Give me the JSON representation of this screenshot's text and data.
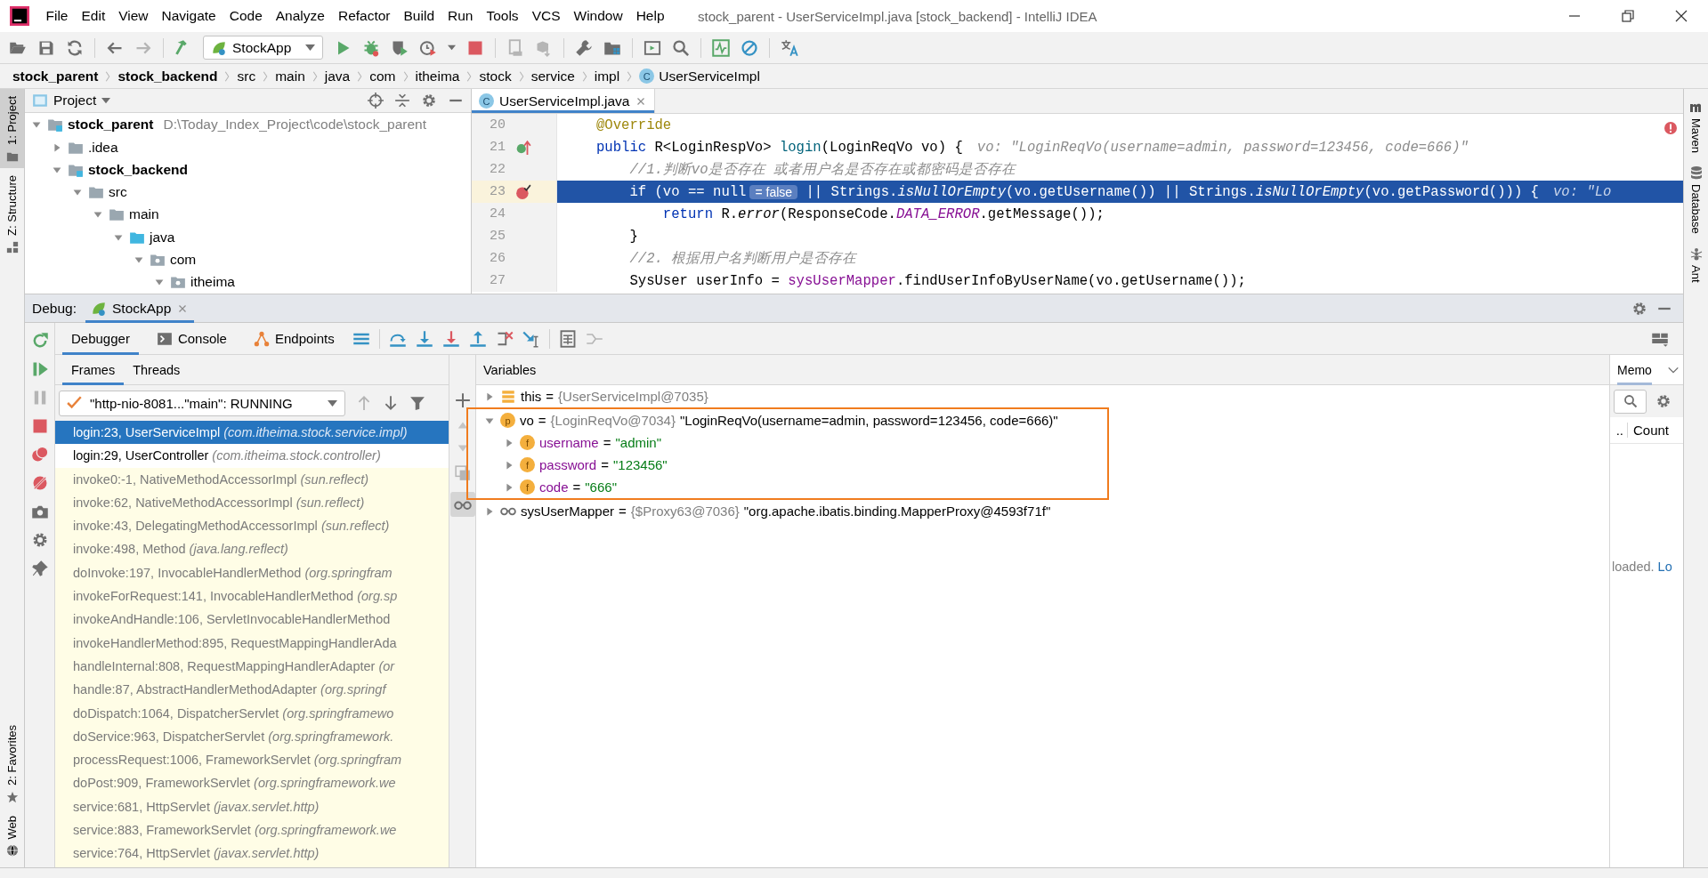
{
  "window": {
    "title": "stock_parent - UserServiceImpl.java [stock_backend] - IntelliJ IDEA"
  },
  "menu": [
    "File",
    "Edit",
    "View",
    "Navigate",
    "Code",
    "Analyze",
    "Refactor",
    "Build",
    "Run",
    "Tools",
    "VCS",
    "Window",
    "Help"
  ],
  "toolbar": {
    "run_configuration": "StockApp"
  },
  "breadcrumb": [
    {
      "label": "stock_parent",
      "kind": "module"
    },
    {
      "label": "stock_backend",
      "kind": "module"
    },
    {
      "label": "src",
      "kind": "folder"
    },
    {
      "label": "main",
      "kind": "folder"
    },
    {
      "label": "java",
      "kind": "folder"
    },
    {
      "label": "com",
      "kind": "folder"
    },
    {
      "label": "itheima",
      "kind": "folder"
    },
    {
      "label": "stock",
      "kind": "folder"
    },
    {
      "label": "service",
      "kind": "folder"
    },
    {
      "label": "impl",
      "kind": "folder"
    },
    {
      "label": "UserServiceImpl",
      "kind": "class",
      "badge": "C"
    }
  ],
  "left_stripe": {
    "top": [
      {
        "label": "1: Project",
        "selected": true
      },
      {
        "label": "Z: Structure",
        "selected": false
      }
    ],
    "bottom": [
      {
        "label": "2: Favorites"
      },
      {
        "label": "Web"
      }
    ]
  },
  "right_stripe": [
    {
      "label": "Maven"
    },
    {
      "label": "Database"
    },
    {
      "label": "Ant"
    }
  ],
  "project": {
    "title": "Project",
    "tree": [
      {
        "label": "stock_parent",
        "detail": "D:\\Today_Index_Project\\code\\stock_parent",
        "kind": "module",
        "expanded": true,
        "children": [
          {
            "label": ".idea",
            "kind": "folder",
            "expanded": false
          },
          {
            "label": "stock_backend",
            "kind": "module",
            "expanded": true,
            "children": [
              {
                "label": "src",
                "kind": "folder",
                "expanded": true,
                "children": [
                  {
                    "label": "main",
                    "kind": "folder",
                    "expanded": true,
                    "children": [
                      {
                        "label": "java",
                        "kind": "source",
                        "expanded": true,
                        "children": [
                          {
                            "label": "com",
                            "kind": "package",
                            "expanded": true,
                            "children": [
                              {
                                "label": "itheima",
                                "kind": "package",
                                "expanded": true
                              }
                            ]
                          }
                        ]
                      }
                    ]
                  }
                ]
              }
            ]
          }
        ]
      }
    ]
  },
  "editor": {
    "tab": {
      "label": "UserServiceImpl.java",
      "badge": "C",
      "selected": true
    },
    "lines": [
      {
        "number": "20",
        "segments": [
          {
            "kind": "code",
            "tokens": [
              {
                "text": "@Override",
                "kind": "annotation"
              }
            ]
          }
        ]
      },
      {
        "number": "21",
        "marker": {
          "kind": "implements"
        },
        "segments": [
          {
            "kind": "code",
            "tokens": [
              {
                "text": "public ",
                "kind": "keyword"
              },
              {
                "text": "R<LoginRespVo> ",
                "kind": "plain"
              },
              {
                "text": "login",
                "kind": "method"
              },
              {
                "text": "(LoginReqVo vo) {",
                "kind": "plain"
              }
            ]
          },
          {
            "kind": "hint",
            "text": "vo: \"LoginReqVo(username=admin, password=123456, code=666)\""
          }
        ]
      },
      {
        "number": "22",
        "segments": [
          {
            "kind": "code",
            "tokens": [
              {
                "text": "    //1.判断vo是否存在 或者用户名是否存在或都密码是否存在",
                "kind": "comment"
              }
            ]
          }
        ]
      },
      {
        "number": "23",
        "marker": {
          "kind": "breakpoint"
        },
        "current": true,
        "segments": [
          {
            "kind": "code",
            "tokens": [
              {
                "text": "    if ",
                "kind": "keyword"
              },
              {
                "text": "(vo == ",
                "kind": "plain"
              },
              {
                "text": "null",
                "kind": "keyword"
              }
            ]
          },
          {
            "kind": "value",
            "text": "= false"
          },
          {
            "kind": "code",
            "tokens": [
              {
                "text": " || Strings.",
                "kind": "plain"
              },
              {
                "text": "isNullOrEmpty",
                "kind": "static"
              },
              {
                "text": "(vo.getUsername()) || Strings.",
                "kind": "plain"
              },
              {
                "text": "isNullOrEmpty",
                "kind": "static"
              },
              {
                "text": "(vo.getPassword())) {",
                "kind": "plain"
              }
            ]
          },
          {
            "kind": "hint",
            "text": "vo: \"Lo"
          }
        ]
      },
      {
        "number": "24",
        "segments": [
          {
            "kind": "code",
            "tokens": [
              {
                "text": "        return ",
                "kind": "keyword"
              },
              {
                "text": "R.",
                "kind": "plain"
              },
              {
                "text": "error",
                "kind": "static"
              },
              {
                "text": "(ResponseCode.",
                "kind": "plain"
              },
              {
                "text": "DATA_ERROR",
                "kind": "constant"
              },
              {
                "text": ".getMessage());",
                "kind": "plain"
              }
            ]
          }
        ]
      },
      {
        "number": "25",
        "segments": [
          {
            "kind": "code",
            "tokens": [
              {
                "text": "    }",
                "kind": "plain"
              }
            ]
          }
        ]
      },
      {
        "number": "26",
        "segments": [
          {
            "kind": "code",
            "tokens": [
              {
                "text": "    //2. 根据用户名判断用户是否存在",
                "kind": "comment"
              }
            ]
          }
        ]
      },
      {
        "number": "27",
        "segments": [
          {
            "kind": "code",
            "tokens": [
              {
                "text": "    SysUser userInfo = ",
                "kind": "plain"
              },
              {
                "text": "sysUserMapper",
                "kind": "field"
              },
              {
                "text": ".findUserInfoByUserName(vo.getUsername());",
                "kind": "plain"
              }
            ]
          }
        ]
      }
    ]
  },
  "debug": {
    "label": "Debug:",
    "sessions": [
      {
        "label": "StockApp",
        "selected": true
      }
    ],
    "tabs": [
      {
        "label": "Debugger",
        "selected": true
      },
      {
        "label": "Console",
        "selected": false
      },
      {
        "label": "Endpoints",
        "selected": false
      }
    ],
    "frame_tabs": [
      {
        "label": "Frames",
        "selected": true
      },
      {
        "label": "Threads",
        "selected": false
      }
    ],
    "thread": "\"http-nio-8081...\"main\": RUNNING",
    "frames": [
      {
        "text": "login:23, UserServiceImpl *(com.itheima.stock.service.impl)*",
        "selected": true,
        "library": false
      },
      {
        "text": "login:29, UserController *(com.itheima.stock.controller)*",
        "selected": false,
        "library": false
      },
      {
        "text": "invoke0:-1, NativeMethodAccessorImpl *(sun.reflect)*",
        "selected": false,
        "library": true
      },
      {
        "text": "invoke:62, NativeMethodAccessorImpl *(sun.reflect)*",
        "selected": false,
        "library": true
      },
      {
        "text": "invoke:43, DelegatingMethodAccessorImpl *(sun.reflect)*",
        "selected": false,
        "library": true
      },
      {
        "text": "invoke:498, Method *(java.lang.reflect)*",
        "selected": false,
        "library": true
      },
      {
        "text": "doInvoke:197, InvocableHandlerMethod *(org.springfram*",
        "selected": false,
        "library": true
      },
      {
        "text": "invokeForRequest:141, InvocableHandlerMethod *(org.sp*",
        "selected": false,
        "library": true
      },
      {
        "text": "invokeAndHandle:106, ServletInvocableHandlerMethod",
        "selected": false,
        "library": true
      },
      {
        "text": "invokeHandlerMethod:895, RequestMappingHandlerAda",
        "selected": false,
        "library": true
      },
      {
        "text": "handleInternal:808, RequestMappingHandlerAdapter *(or*",
        "selected": false,
        "library": true
      },
      {
        "text": "handle:87, AbstractHandlerMethodAdapter *(org.springf*",
        "selected": false,
        "library": true
      },
      {
        "text": "doDispatch:1064, DispatcherServlet *(org.springframewo*",
        "selected": false,
        "library": true
      },
      {
        "text": "doService:963, DispatcherServlet *(org.springframework.*",
        "selected": false,
        "library": true
      },
      {
        "text": "processRequest:1006, FrameworkServlet *(org.springfram*",
        "selected": false,
        "library": true
      },
      {
        "text": "doPost:909, FrameworkServlet *(org.springframework.we*",
        "selected": false,
        "library": true
      },
      {
        "text": "service:681, HttpServlet *(javax.servlet.http)*",
        "selected": false,
        "library": true
      },
      {
        "text": "service:883, FrameworkServlet *(org.springframework.we*",
        "selected": false,
        "library": true
      },
      {
        "text": "service:764, HttpServlet *(javax.servlet.http)*",
        "selected": false,
        "library": true
      }
    ],
    "variables_title": "Variables",
    "variables": [
      {
        "name": "this",
        "kind": "this",
        "operator": "=",
        "type": "{UserServiceImpl@7035}",
        "expanded": false
      },
      {
        "name": "vo",
        "kind": "parameter",
        "badge": "p",
        "operator": "=",
        "type": "{LoginReqVo@7034}",
        "value": "\"LoginReqVo(username=admin, password=123456, code=666)\"",
        "expanded": true,
        "outlined": true,
        "children": [
          {
            "name": "username",
            "kind": "field",
            "badge": "f",
            "operator": "=",
            "value": "\"admin\"",
            "expanded": false
          },
          {
            "name": "password",
            "kind": "field",
            "badge": "f",
            "operator": "=",
            "value": "\"123456\"",
            "expanded": false
          },
          {
            "name": "code",
            "kind": "field",
            "badge": "f",
            "operator": "=",
            "value": "\"666\"",
            "expanded": false
          }
        ]
      },
      {
        "name": "sysUserMapper",
        "kind": "watch",
        "operator": "=",
        "type": "{$Proxy63@7036}",
        "value": "\"org.apache.ibatis.binding.MapperProxy@4593f71f\"",
        "expanded": false
      }
    ],
    "memory": {
      "tab": "Memo",
      "columns": [
        "..",
        "Count"
      ],
      "status": "loaded.",
      "link": "Lo"
    }
  }
}
